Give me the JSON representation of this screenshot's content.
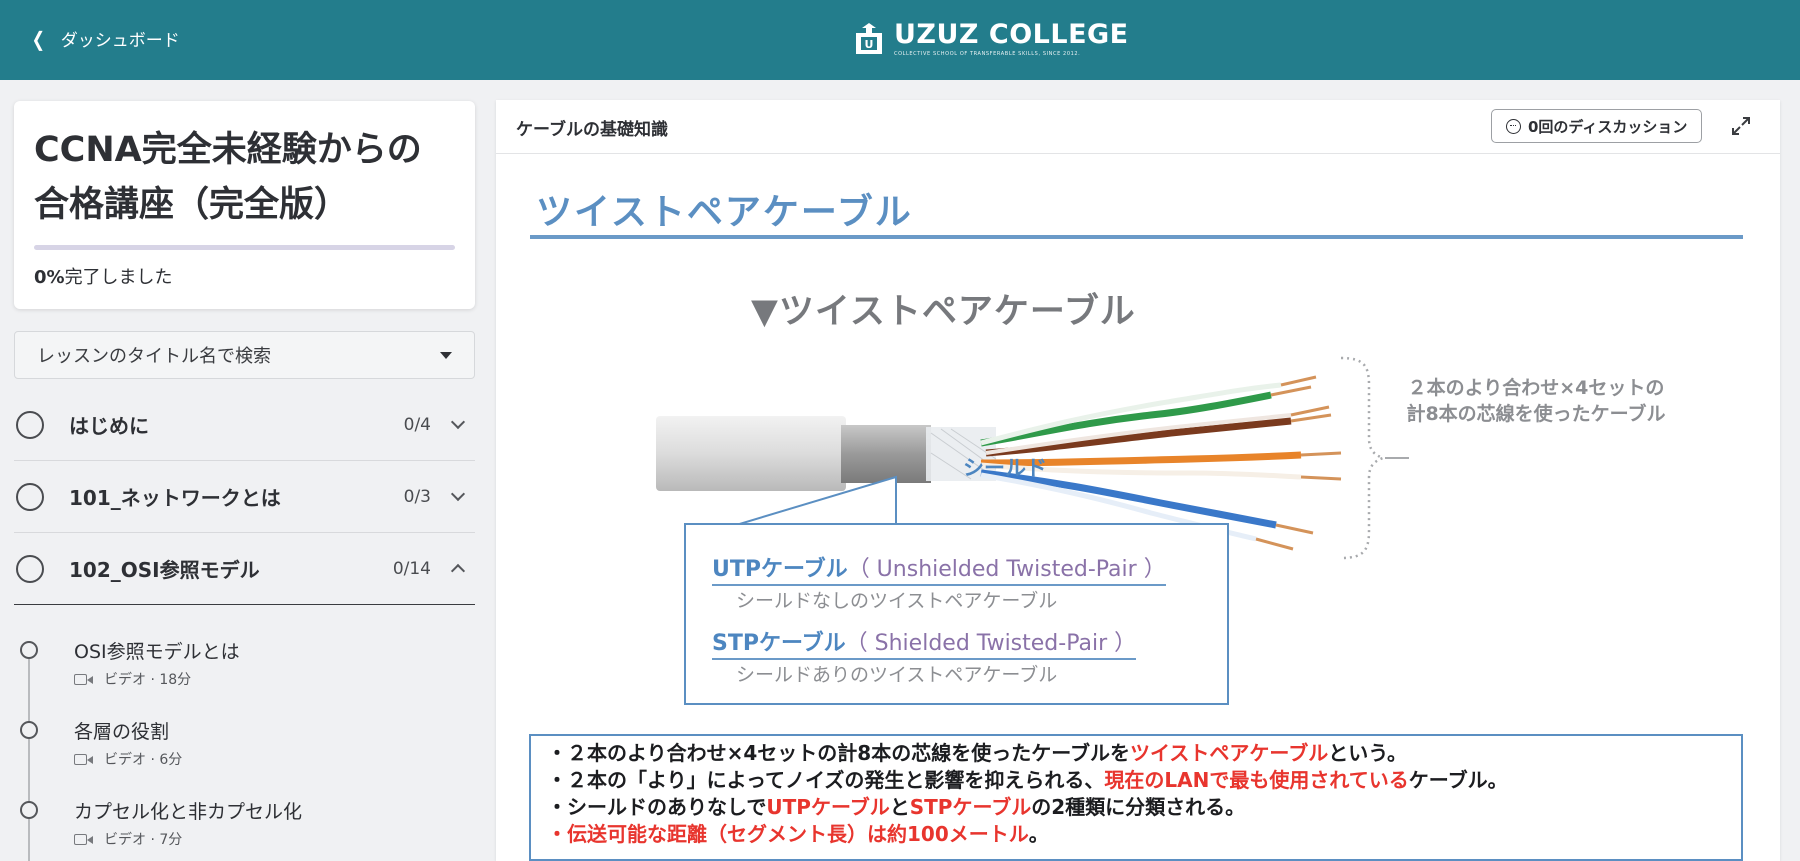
{
  "header": {
    "back_label": "ダッシュボード",
    "logo_title": "UZUZ COLLEGE",
    "logo_tagline": "COLLECTIVE SCHOOL OF TRANSFERABLE SKILLS, SINCE 2012."
  },
  "course": {
    "title": "CCNA完全未経験からの合格講座（完全版）",
    "progress_percent": 0,
    "progress_value": "0%",
    "progress_suffix": "完了しました"
  },
  "search": {
    "placeholder": "レッスンのタイトル名で検索"
  },
  "sections": [
    {
      "title": "はじめに",
      "count": "0/4",
      "expanded": false
    },
    {
      "title": "101_ネットワークとは",
      "count": "0/3",
      "expanded": false
    },
    {
      "title": "102_OSI参照モデル",
      "count": "0/14",
      "expanded": true
    }
  ],
  "lessons": [
    {
      "title": "OSI参照モデルとは",
      "meta": "ビデオ · 18分"
    },
    {
      "title": "各層の役割",
      "meta": "ビデオ · 6分"
    },
    {
      "title": "カプセル化と非カプセル化",
      "meta": "ビデオ · 7分"
    }
  ],
  "main": {
    "lesson_name": "ケーブルの基礎知識",
    "discussion_label": "0回のディスカッション"
  },
  "slide": {
    "title": "ツイストペアケーブル",
    "subtitle": "▼ツイストペアケーブル",
    "shield_label": "シールド",
    "note_line1": "２本のより合わせ×4セットの",
    "note_line2": "計8本の芯線を使ったケーブル",
    "utp_key": "UTPケーブル",
    "utp_paren": "（ Unshielded Twisted-Pair ）",
    "utp_desc": "シールドなしのツイストペアケーブル",
    "stp_key": "STPケーブル",
    "stp_paren": "（ Shielded Twisted-Pair ）",
    "stp_desc": "シールドありのツイストペアケーブル",
    "bullet1_a": "・２本のより合わせ×4セットの計8本の芯線を使ったケーブルを",
    "bullet1_b": "ツイストペアケーブル",
    "bullet1_c": "という。",
    "bullet2_a": "・２本の「より」によってノイズの発生と影響を抑えられる、",
    "bullet2_b": "現在のLANで最も使用されている",
    "bullet2_c": "ケーブル。",
    "bullet3_a": "・シールドのありなしで",
    "bullet3_b": "UTPケーブル",
    "bullet3_c": "と",
    "bullet3_d": "STPケーブル",
    "bullet3_e": "の2種類に分類される。",
    "bullet4_a": "・",
    "bullet4_b": "伝送可能な距離（セグメント長）は約100メートル",
    "bullet4_c": "。"
  },
  "colors": {
    "header_bg": "#237d8c",
    "accent_blue": "#5b8fc2",
    "highlight_red": "#e8352e",
    "progress_fill": "#7b6fc2"
  }
}
